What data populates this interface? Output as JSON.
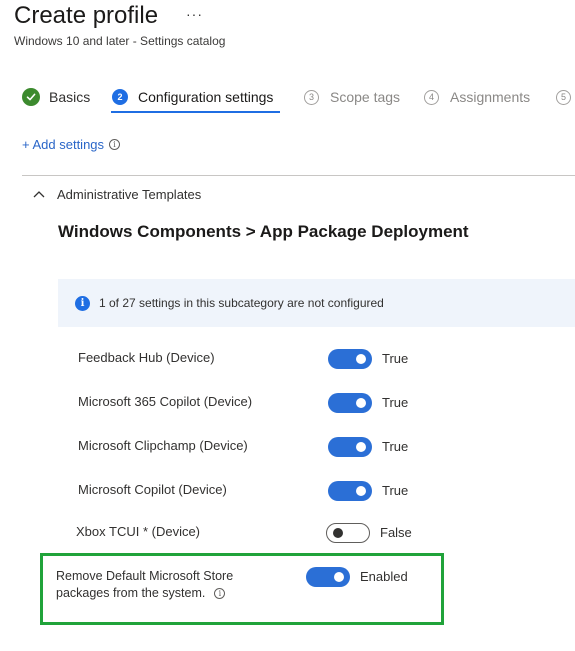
{
  "header": {
    "title": "Create profile",
    "more_glyph": "···",
    "subtitle": "Windows 10 and later - Settings catalog"
  },
  "wizard": {
    "steps": [
      {
        "number": "✓",
        "label": "Basics",
        "state": "done"
      },
      {
        "number": "2",
        "label": "Configuration settings",
        "state": "active"
      },
      {
        "number": "3",
        "label": "Scope tags",
        "state": "pending"
      },
      {
        "number": "4",
        "label": "Assignments",
        "state": "pending"
      },
      {
        "number": "5",
        "label": "",
        "state": "pending"
      }
    ]
  },
  "add_settings": {
    "label": "+ Add settings",
    "info_icon": "i"
  },
  "section": {
    "title": "Administrative Templates",
    "category": "Windows Components > App Package Deployment",
    "info_banner": "1 of 27 settings in this subcategory are not configured",
    "info_icon": "i"
  },
  "settings": [
    {
      "label": "Feedback Hub (Device)",
      "value": "True",
      "on": true
    },
    {
      "label": "Microsoft 365 Copilot (Device)",
      "value": "True",
      "on": true
    },
    {
      "label": "Microsoft Clipchamp (Device)",
      "value": "True",
      "on": true
    },
    {
      "label": "Microsoft Copilot (Device)",
      "value": "True",
      "on": true
    },
    {
      "label": "Xbox TCUI * (Device)",
      "value": "False",
      "on": false
    }
  ],
  "highlighted_setting": {
    "label_line1": "Remove Default Microsoft Store",
    "label_line2": "packages from the system.",
    "info_icon": "i",
    "value": "Enabled",
    "on": true
  },
  "colors": {
    "accent": "#1f6ee3",
    "toggle_on": "#2b6fd6",
    "step_done": "#3c8a2e",
    "highlight_border": "#20a33a",
    "banner_bg": "#eff4fb",
    "link": "#2a66c8"
  }
}
